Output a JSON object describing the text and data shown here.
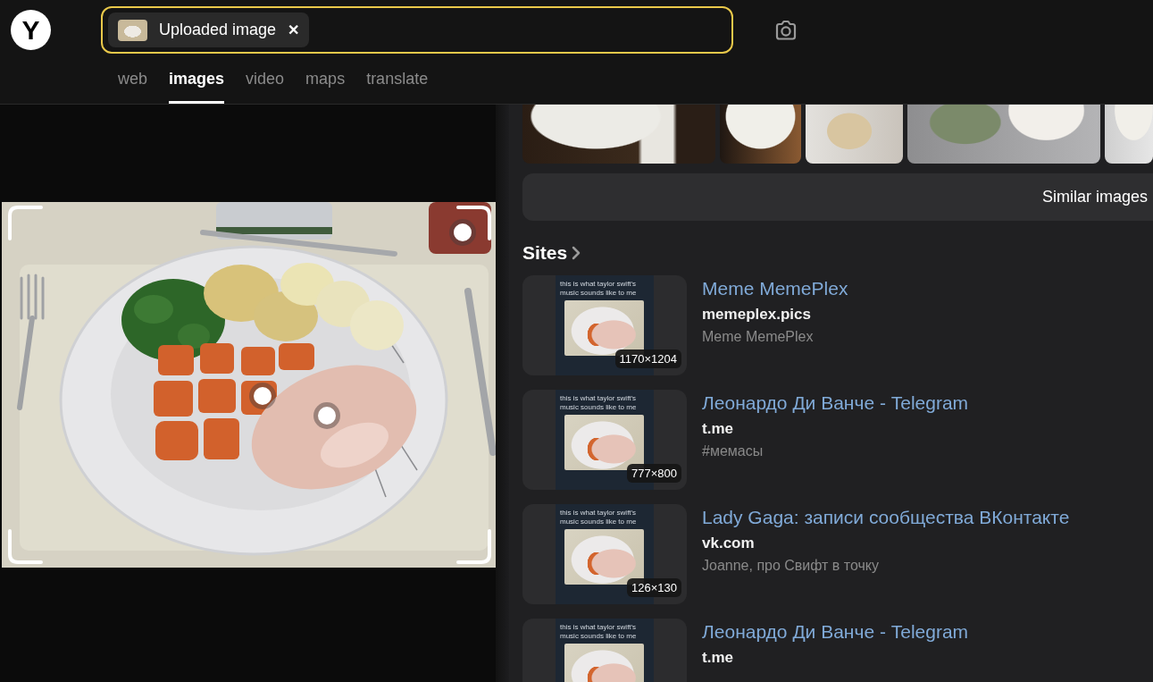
{
  "header": {
    "logo": "Y",
    "search": {
      "chip_label": "Uploaded image",
      "chip_close": "✕"
    },
    "tabs": [
      {
        "label": "web",
        "selected": false
      },
      {
        "label": "images",
        "selected": true
      },
      {
        "label": "video",
        "selected": false
      },
      {
        "label": "maps",
        "selected": false
      },
      {
        "label": "translate",
        "selected": false
      }
    ]
  },
  "similar_images_button": "Similar images",
  "sites": {
    "heading": "Sites",
    "results": [
      {
        "title": "Meme MemePlex",
        "domain": "memeplex.pics",
        "description": "Meme MemePlex",
        "size": "1170×1204",
        "thumbnail_caption": "this is what taylor swift's music sounds like to me"
      },
      {
        "title": "Леонардо Ди Ванче - Telegram",
        "domain": "t.me",
        "description": "#мемасы",
        "size": "777×800",
        "thumbnail_caption": "this is what taylor swift's music sounds like to me"
      },
      {
        "title": "Lady Gaga: записи сообщества ВКонтакте",
        "domain": "vk.com",
        "description": "Joanne, про Свифт в точку",
        "size": "126×130",
        "thumbnail_caption": "this is what taylor swift's music sounds like to me"
      },
      {
        "title": "Леонардо Ди Ванче - Telegram",
        "domain": "t.me",
        "thumbnail_caption": "this is what taylor swift's music sounds like to me"
      }
    ]
  }
}
